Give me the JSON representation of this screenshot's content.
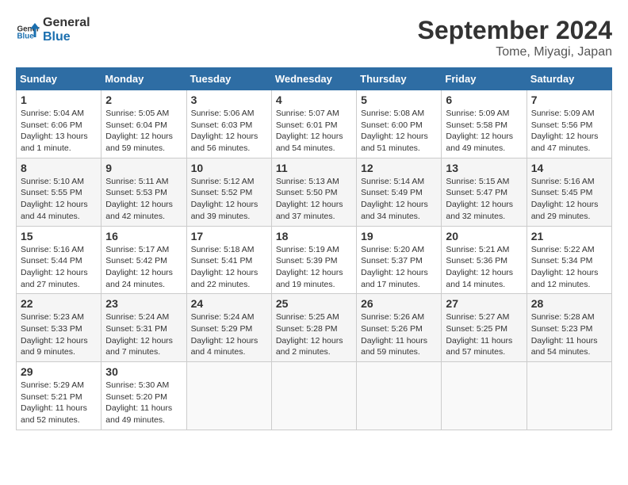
{
  "header": {
    "logo_general": "General",
    "logo_blue": "Blue",
    "month": "September 2024",
    "location": "Tome, Miyagi, Japan"
  },
  "columns": [
    "Sunday",
    "Monday",
    "Tuesday",
    "Wednesday",
    "Thursday",
    "Friday",
    "Saturday"
  ],
  "weeks": [
    [
      {
        "day": "1",
        "detail": "Sunrise: 5:04 AM\nSunset: 6:06 PM\nDaylight: 13 hours\nand 1 minute."
      },
      {
        "day": "2",
        "detail": "Sunrise: 5:05 AM\nSunset: 6:04 PM\nDaylight: 12 hours\nand 59 minutes."
      },
      {
        "day": "3",
        "detail": "Sunrise: 5:06 AM\nSunset: 6:03 PM\nDaylight: 12 hours\nand 56 minutes."
      },
      {
        "day": "4",
        "detail": "Sunrise: 5:07 AM\nSunset: 6:01 PM\nDaylight: 12 hours\nand 54 minutes."
      },
      {
        "day": "5",
        "detail": "Sunrise: 5:08 AM\nSunset: 6:00 PM\nDaylight: 12 hours\nand 51 minutes."
      },
      {
        "day": "6",
        "detail": "Sunrise: 5:09 AM\nSunset: 5:58 PM\nDaylight: 12 hours\nand 49 minutes."
      },
      {
        "day": "7",
        "detail": "Sunrise: 5:09 AM\nSunset: 5:56 PM\nDaylight: 12 hours\nand 47 minutes."
      }
    ],
    [
      {
        "day": "8",
        "detail": "Sunrise: 5:10 AM\nSunset: 5:55 PM\nDaylight: 12 hours\nand 44 minutes."
      },
      {
        "day": "9",
        "detail": "Sunrise: 5:11 AM\nSunset: 5:53 PM\nDaylight: 12 hours\nand 42 minutes."
      },
      {
        "day": "10",
        "detail": "Sunrise: 5:12 AM\nSunset: 5:52 PM\nDaylight: 12 hours\nand 39 minutes."
      },
      {
        "day": "11",
        "detail": "Sunrise: 5:13 AM\nSunset: 5:50 PM\nDaylight: 12 hours\nand 37 minutes."
      },
      {
        "day": "12",
        "detail": "Sunrise: 5:14 AM\nSunset: 5:49 PM\nDaylight: 12 hours\nand 34 minutes."
      },
      {
        "day": "13",
        "detail": "Sunrise: 5:15 AM\nSunset: 5:47 PM\nDaylight: 12 hours\nand 32 minutes."
      },
      {
        "day": "14",
        "detail": "Sunrise: 5:16 AM\nSunset: 5:45 PM\nDaylight: 12 hours\nand 29 minutes."
      }
    ],
    [
      {
        "day": "15",
        "detail": "Sunrise: 5:16 AM\nSunset: 5:44 PM\nDaylight: 12 hours\nand 27 minutes."
      },
      {
        "day": "16",
        "detail": "Sunrise: 5:17 AM\nSunset: 5:42 PM\nDaylight: 12 hours\nand 24 minutes."
      },
      {
        "day": "17",
        "detail": "Sunrise: 5:18 AM\nSunset: 5:41 PM\nDaylight: 12 hours\nand 22 minutes."
      },
      {
        "day": "18",
        "detail": "Sunrise: 5:19 AM\nSunset: 5:39 PM\nDaylight: 12 hours\nand 19 minutes."
      },
      {
        "day": "19",
        "detail": "Sunrise: 5:20 AM\nSunset: 5:37 PM\nDaylight: 12 hours\nand 17 minutes."
      },
      {
        "day": "20",
        "detail": "Sunrise: 5:21 AM\nSunset: 5:36 PM\nDaylight: 12 hours\nand 14 minutes."
      },
      {
        "day": "21",
        "detail": "Sunrise: 5:22 AM\nSunset: 5:34 PM\nDaylight: 12 hours\nand 12 minutes."
      }
    ],
    [
      {
        "day": "22",
        "detail": "Sunrise: 5:23 AM\nSunset: 5:33 PM\nDaylight: 12 hours\nand 9 minutes."
      },
      {
        "day": "23",
        "detail": "Sunrise: 5:24 AM\nSunset: 5:31 PM\nDaylight: 12 hours\nand 7 minutes."
      },
      {
        "day": "24",
        "detail": "Sunrise: 5:24 AM\nSunset: 5:29 PM\nDaylight: 12 hours\nand 4 minutes."
      },
      {
        "day": "25",
        "detail": "Sunrise: 5:25 AM\nSunset: 5:28 PM\nDaylight: 12 hours\nand 2 minutes."
      },
      {
        "day": "26",
        "detail": "Sunrise: 5:26 AM\nSunset: 5:26 PM\nDaylight: 11 hours\nand 59 minutes."
      },
      {
        "day": "27",
        "detail": "Sunrise: 5:27 AM\nSunset: 5:25 PM\nDaylight: 11 hours\nand 57 minutes."
      },
      {
        "day": "28",
        "detail": "Sunrise: 5:28 AM\nSunset: 5:23 PM\nDaylight: 11 hours\nand 54 minutes."
      }
    ],
    [
      {
        "day": "29",
        "detail": "Sunrise: 5:29 AM\nSunset: 5:21 PM\nDaylight: 11 hours\nand 52 minutes."
      },
      {
        "day": "30",
        "detail": "Sunrise: 5:30 AM\nSunset: 5:20 PM\nDaylight: 11 hours\nand 49 minutes."
      },
      {
        "day": "",
        "detail": ""
      },
      {
        "day": "",
        "detail": ""
      },
      {
        "day": "",
        "detail": ""
      },
      {
        "day": "",
        "detail": ""
      },
      {
        "day": "",
        "detail": ""
      }
    ]
  ]
}
